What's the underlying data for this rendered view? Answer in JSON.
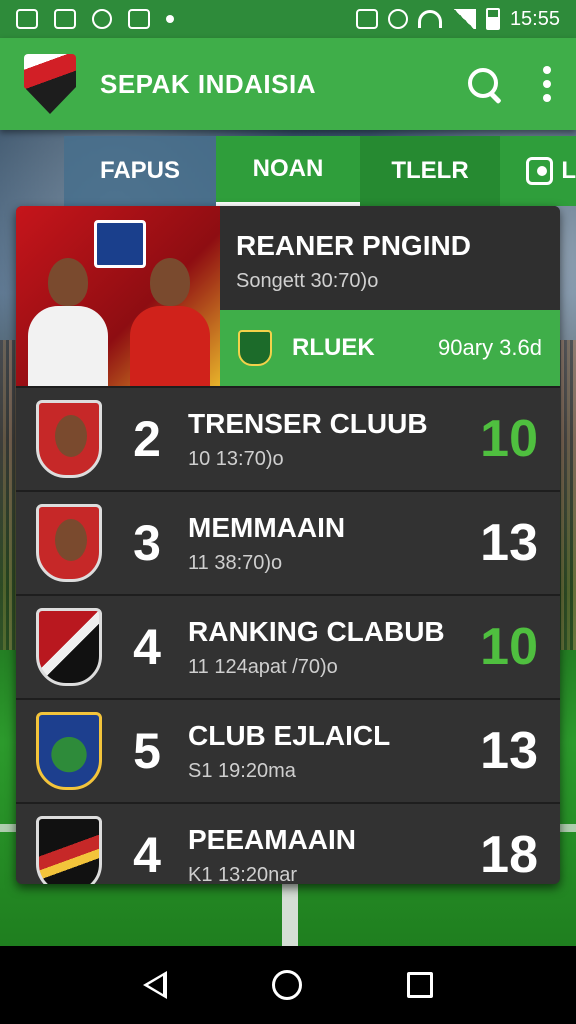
{
  "status_bar": {
    "time": "15:55"
  },
  "app_bar": {
    "title": "SEPAK INDAISIA"
  },
  "tabs": [
    {
      "label": "FAPUS"
    },
    {
      "label": "NOAN",
      "active": true
    },
    {
      "label": "TLELR"
    },
    {
      "label": "L"
    }
  ],
  "featured": {
    "title": "REANER PNGIND",
    "subtitle": "Songett 30:70)o",
    "club": "RLUEK",
    "meta": "90ary 3.6d"
  },
  "rows": [
    {
      "rank": "2",
      "name": "TRENSER CLUUB",
      "sub": "10 13:70)o",
      "score": "10",
      "score_color": "green",
      "crest": "face"
    },
    {
      "rank": "3",
      "name": "MEMMAAIN",
      "sub": "11 38:70)o",
      "score": "13",
      "score_color": "white",
      "crest": "face"
    },
    {
      "rank": "4",
      "name": "RANKING CLABUB",
      "sub": "11 124apat /70)o",
      "score": "10",
      "score_color": "green",
      "crest": "red-black"
    },
    {
      "rank": "5",
      "name": "CLUB EJLAICL",
      "sub": "S1 19:20ma",
      "score": "13",
      "score_color": "white",
      "crest": "blue-green"
    },
    {
      "rank": "4",
      "name": "PEEAMAAIN",
      "sub": "K1 13:20nar",
      "score": "18",
      "score_color": "white",
      "crest": "black-gold"
    }
  ],
  "colors": {
    "primary": "#3fae49",
    "status": "#2e8b3a",
    "score_green": "#4fbf3f",
    "panel": "#323232"
  }
}
